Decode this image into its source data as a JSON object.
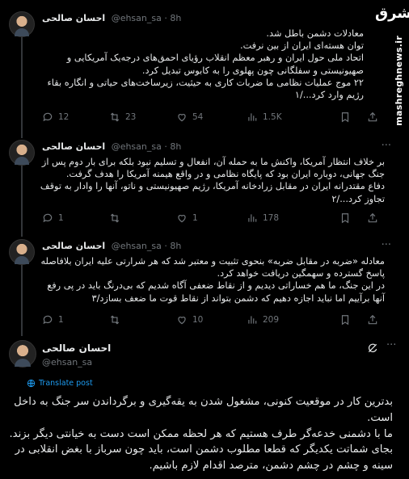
{
  "watermark": {
    "logo_text": "مشرق",
    "url": "mashreghnews.ir"
  },
  "tweets": [
    {
      "name": "احسان صالحی",
      "handle": "@ehsan_sa",
      "time": "· 8h",
      "body": "معادلات دشمن باطل شد.\nتوان هسته‌ای ایران از بین نرفت.\nاتحاد ملی حول ایران و رهبر معظم انقلاب رؤیای احمق‌های درجه‌یک آمریکایی و صهیونیستی و سفلگانی چون پهلوی را به کابوس تبدیل کرد.\n۲۲ موج عملیات نظامی ما ضربات کاری به حیثیت، زیرساخت‌های حیاتی و انگاره بقاء رژیم وارد کرد.../۱",
      "replies": "12",
      "reposts": "23",
      "likes": "54",
      "views": "1.5K"
    },
    {
      "name": "احسان صالحی",
      "handle": "@ehsan_sa",
      "time": "· 8h",
      "body": "بر خلاف انتظار آمریکا، واکنش ما به حمله آن، انفعال و تسلیم نبود بلکه برای بار دوم پس از جنگ جهانی، دوباره ایران بود که پایگاه نظامی و در واقع هیمنه آمریکا را هدف گرفت.\nدفاع مقتدرانه ایران در مقابل زرادخانه آمریکا، رژیم صهیونیستی و ناتو، آنها را وادار به توقف تجاوز کرد.../۲",
      "replies": "1",
      "reposts": "",
      "likes": "1",
      "views": "178"
    },
    {
      "name": "احسان صالحی",
      "handle": "@ehsan_sa",
      "time": "· 8h",
      "body": "معادله «ضربه در مقابل ضربه» بنحوی تثبیت و معتبر شد که هر شرارتی علیه ایران بلافاصله پاسخ گسترده و سهمگین دریافت خواهد کرد.\nدر این جنگ، ما هم خساراتی دیدیم و از نقاط ضعفی آگاه شدیم که بی‌درنگ باید در پی رفع آنها برآییم اما نباید اجازه دهیم که دشمن بتواند از نقاط قوت ما ضعف بسازد/۳",
      "replies": "1",
      "reposts": "",
      "likes": "10",
      "views": "209"
    }
  ],
  "main_tweet": {
    "name": "احسان صالحی",
    "handle": "@ehsan_sa",
    "translate": "Translate post",
    "body": "بدترین کار در موقعیت کنونی، مشغول شدن به یقه‌گیری و برگرداندن سر جنگ به داخل است.\nما با دشمنی خدعه‌گر طرف هستیم که هر لحظه ممکن است دست به خیانتی دیگر بزند. بجای شماتت یکدیگر که قطعا مطلوب دشمن است، باید چون سرباز با بغض انقلابی در سینه و چشم در چشم دشمن، مترصد اقدام لازم باشیم."
  },
  "icons": [
    "reply-icon",
    "repost-icon",
    "like-icon",
    "views-icon",
    "bookmark-icon",
    "share-icon",
    "more-icon",
    "grok-icon",
    "translate-icon"
  ]
}
